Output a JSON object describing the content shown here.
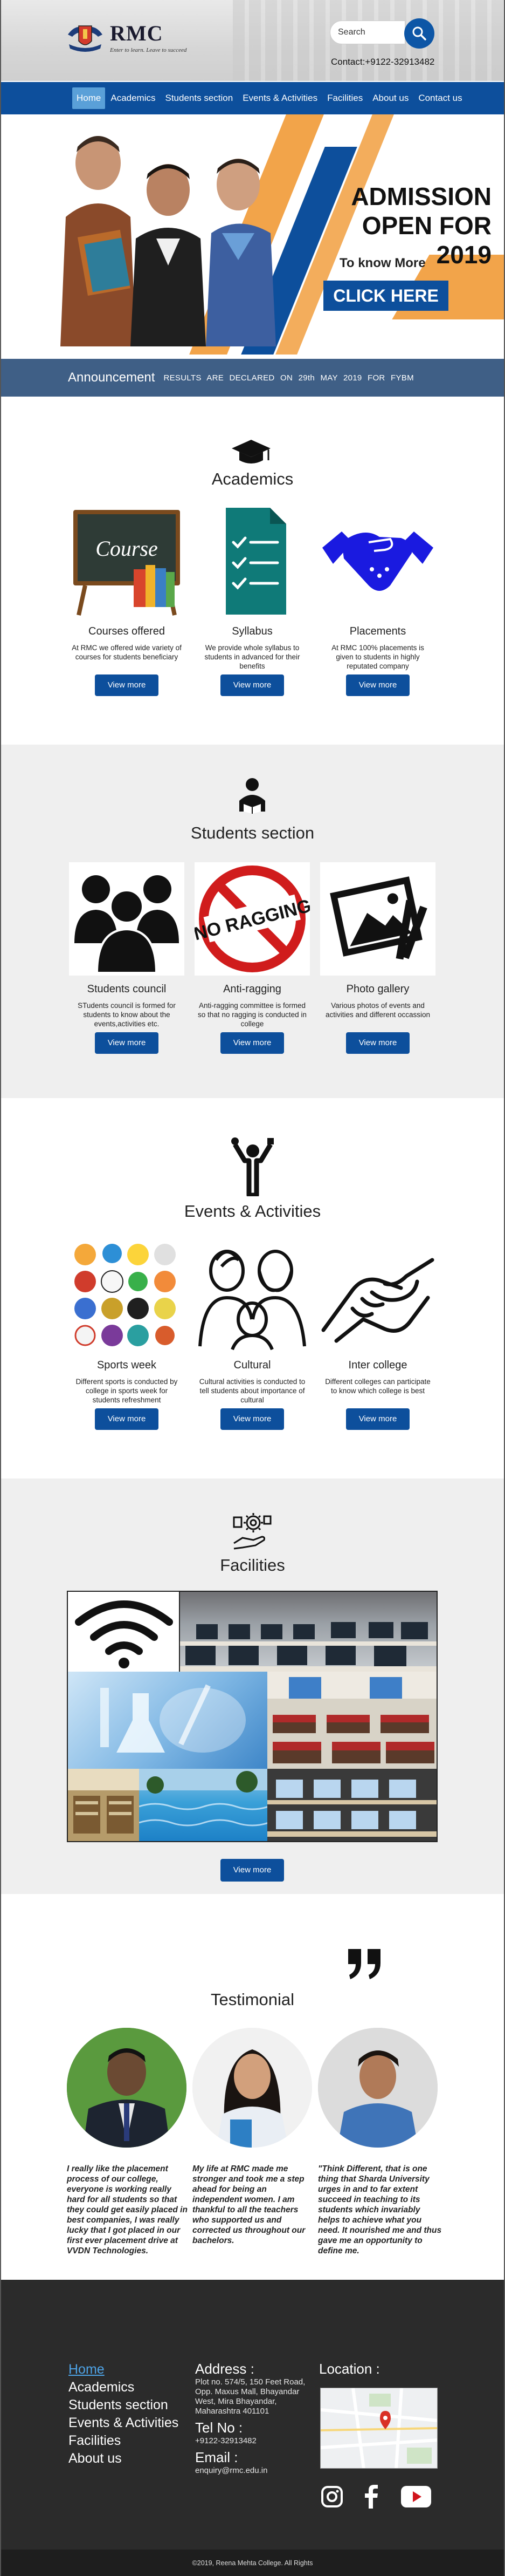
{
  "brand": {
    "name": "RMC",
    "tagline": "Enter to learn. Leave to succeed"
  },
  "search": {
    "placeholder": "Search"
  },
  "contact": "Contact:+9122-32913482",
  "nav": [
    "Home",
    "Academics",
    "Students section",
    "Events & Activities",
    "Facilities",
    "About us",
    "Contact us"
  ],
  "hero": {
    "headline_1": "ADMISSION",
    "headline_2": "OPEN FOR 2019",
    "subtext": "To know More",
    "cta": "CLICK HERE"
  },
  "announcement": {
    "label": "Announcement",
    "text": "RESULTS ARE DECLARED ON 29th MAY 2019 FOR FYBM"
  },
  "academics": {
    "title": "Academics",
    "cards": [
      {
        "title": "Courses offered",
        "desc": "At RMC we offered wide variety of courses for students beneficiary",
        "button": "View more",
        "img_label": "Course"
      },
      {
        "title": "Syllabus",
        "desc": "We provide whole syllabus to students in advanced for their benefits",
        "button": "View more"
      },
      {
        "title": "Placements",
        "desc": "At RMC 100% placements is given to students in highly reputated company",
        "button": "View more"
      }
    ]
  },
  "students": {
    "title": "Students section",
    "cards": [
      {
        "title": "Students council",
        "desc": "STudents council is formed for students to know about the events,activities etc.",
        "button": "View more"
      },
      {
        "title": "Anti-ragging",
        "desc": "Anti-ragging committee is formed so that no ragging is conducted in college",
        "button": "View more",
        "img_label": "NO RAGGING"
      },
      {
        "title": "Photo gallery",
        "desc": "Various photos of events and activities and different occassion",
        "button": "View more"
      }
    ]
  },
  "events": {
    "title": "Events & Activities",
    "cards": [
      {
        "title": "Sports week",
        "desc": "Different sports is conducted by college in sports week for students refreshment",
        "button": "View more"
      },
      {
        "title": "Cultural",
        "desc": "Cultural activities is conducted to tell students about importance of cultural",
        "button": "View more"
      },
      {
        "title": "Inter college",
        "desc": "Different colleges can participate to know which college is best",
        "button": "View more"
      }
    ]
  },
  "facilities": {
    "title": "Facilities",
    "button": "View more"
  },
  "testimonial": {
    "title": "Testimonial",
    "quotes": [
      "I really like the placement process of our college, everyone is working really hard for all students so that they could get easily placed in best companies, I was really lucky that I got placed in our first ever placement drive at VVDN Technologies.",
      "My life at RMC made me stronger and took me a step ahead for being an independent women. I am thankful to all the teachers who supported us and corrected us throughout our bachelors.",
      "\"Think Different, that is one thing that Sharda University urges in and to far extent succeed in teaching to its students which invariably helps to achieve what you need. It nourished me and thus gave me an opportunity to define me."
    ]
  },
  "footer": {
    "links": [
      "Home",
      "Academics",
      "Students section",
      "Events & Activities",
      "Facilities",
      "About us"
    ],
    "address_label": "Address",
    "address": "Plot no. 574/5, 150 Feet Road, Opp. Maxus Mall, Bhayandar West, Mira Bhayandar, Maharashtra 401101",
    "tel_label": "Tel No",
    "tel": "+9122-32913482",
    "email_label": "Email",
    "email": "enquiry@rmc.edu.in",
    "location_label": "Location",
    "social": [
      "instagram-icon",
      "facebook-icon",
      "youtube-icon"
    ]
  },
  "copyright": "©2019, Reena Mehta College. All Rights",
  "colors": {
    "primary": "#0d4f9c",
    "accent": "#f2a44a",
    "announce": "#3f5f86",
    "footer": "#2b2b2b"
  }
}
